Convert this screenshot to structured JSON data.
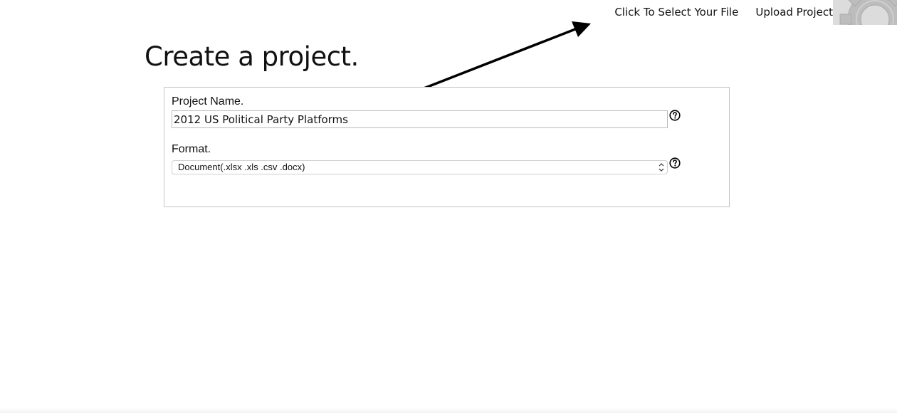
{
  "nav": {
    "select_file": "Click To Select Your File",
    "upload_project": "Upload Project",
    "settings_icon": "gear-icon"
  },
  "page": {
    "title": "Create a project."
  },
  "form": {
    "project_name_label": "Project Name.",
    "project_name_value": "2012 US Political Party Platforms",
    "format_label": "Format.",
    "format_selected": "Document(.xlsx .xls .csv .docx)",
    "help_icon": "question-circle-icon"
  },
  "colors": {
    "panel_border": "#c4c4c4",
    "gear_background": "#dcdcdc",
    "arrow": "#000000"
  }
}
